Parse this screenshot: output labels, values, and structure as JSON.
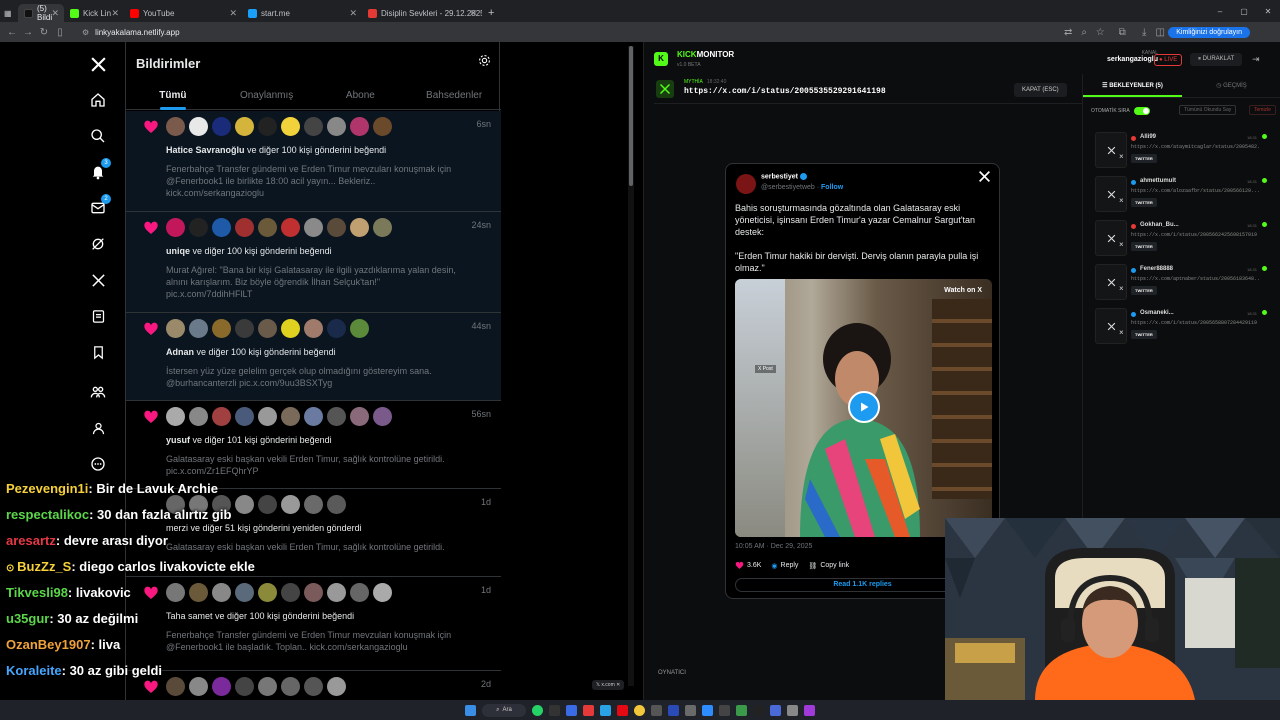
{
  "browser": {
    "tabs": [
      {
        "label": "(5) Bildi",
        "color": "#111"
      },
      {
        "label": "Kick Lin",
        "color": "#53fc18"
      },
      {
        "label": "YouTube",
        "color": "#ff0000"
      },
      {
        "label": "start.me",
        "color": "#18a0fb"
      },
      {
        "label": "Disiplin Sevkleri - 29.12.2025 -",
        "color": "#e53935"
      }
    ],
    "new_tab": "+",
    "url": "linkyakalama.netlify.app",
    "verify_label": "Kimliğinizi doğrulayın"
  },
  "x_sidebar": {
    "icons": [
      "x-logo-icon",
      "home-icon",
      "search-icon",
      "notifications-icon",
      "messages-icon",
      "grok-icon",
      "x-premium-icon",
      "lists-icon",
      "bookmarks-icon",
      "communities-icon",
      "profile-icon",
      "more-icon"
    ],
    "notif_badge": "3",
    "msg_badge": "2"
  },
  "notifications": {
    "title": "Bildirimler",
    "tabs": [
      "Tümü",
      "Onaylanmış",
      "Abone",
      "Bahsedenler"
    ],
    "items": [
      {
        "time": "6sn",
        "user": "Hatice Savranoğlu",
        "action": "ve diğer 100 kişi gönderini beğendi",
        "quote": "Fenerbahçe Transfer gündemi ve Erden Timur mevzuları konuşmak için @Fenerbook1 ile birlikte 18:00 acil yayın... Bekleriz.. kick.com/serkangazioglu"
      },
      {
        "time": "24sn",
        "user": "uniqe",
        "action": "ve diğer 100 kişi gönderini beğendi",
        "quote": "Murat Ağırel: \"Bana bir kişi Galatasaray ile ilgili yazdıklarıma yalan desin, alnını karışlarım. Biz böyle öğrendik İlhan Selçuk'tan!\" pic.x.com/7ddihHFlLT"
      },
      {
        "time": "44sn",
        "user": "Adnan",
        "action": "ve diğer 100 kişi gönderini beğendi",
        "quote": "İstersen yüz yüze gelelim gerçek olup olmadığını göstereyim sana. @burhancanterzli pic.x.com/9uu3BSXTyg"
      },
      {
        "time": "56sn",
        "user": "yusuf",
        "action": "ve diğer 101 kişi gönderini beğendi",
        "quote": "Galatasaray eski başkan vekili Erden Timur, sağlık kontrolüne getirildi. pic.x.com/Zr1EFQhrYP"
      },
      {
        "time": "1d",
        "user": "",
        "action": "merzi ve diğer 51 kişi gönderini yeniden gönderdi",
        "quote": "Galatasaray eski başkan vekili Erden Timur, sağlık kontrolüne getirildi."
      },
      {
        "time": "1d",
        "user": "",
        "action": "Taha samet ve diğer 100 kişi gönderini beğendi",
        "quote": "Fenerbahçe Transfer gündemi ve Erden Timur mevzuları konuşmak için @Fenerbook1 ile başladık. Toplan.. kick.com/serkangazioglu"
      },
      {
        "time": "2d",
        "user": "",
        "action": "",
        "quote": ""
      }
    ]
  },
  "chat": [
    {
      "user": "Pezevengin1i",
      "color": "#f7d13b",
      "msg": ": Bir de Lavuk Archie"
    },
    {
      "user": "respectalikoc",
      "color": "#5cd64b",
      "msg": ": 30 dan fazla alırtız gib"
    },
    {
      "user": "aresartz",
      "color": "#e63946",
      "msg": ": devre arası diyor"
    },
    {
      "user": "BuzZz_S",
      "color": "#f7d13b",
      "msg": ": diego carlos livakovicte ekle"
    },
    {
      "user": "Tikvesli98",
      "color": "#5cd64b",
      "msg": ": livakovic"
    },
    {
      "user": "u35gur",
      "color": "#5cd64b",
      "msg": ": 30 az değilmi"
    },
    {
      "user": "OzanBey1907",
      "color": "#f0a23b",
      "msg": ": liva"
    },
    {
      "user": "Koraleite",
      "color": "#47a6ff",
      "msg": ": 30 az gibi geldi"
    }
  ],
  "kickmonitor": {
    "brand_a": "KICK",
    "brand_b": "MONITOR",
    "version": "v1.0 BETA",
    "channel_label": "KANAL",
    "channel": "serkangazioglu",
    "live": "● LIVE",
    "pause": "⏸ DURAKLAT",
    "current_user": "MYTHİA",
    "current_time": "18:32:40",
    "current_link": "https://x.com/i/status/2005535529291641198",
    "close": "KAPAT (ESC)",
    "tab_waiting": "BEKLEYENLER (5)",
    "tab_history": "GEÇMİŞ",
    "auto_label": "OTOMATİK SIRA",
    "clear_label": "Tümünü Okundu Say",
    "delete_label": "Temizle",
    "queue": [
      {
        "user": "Alli99",
        "dot": "#e53935",
        "time": "18:31",
        "link": "https://x.com/ataymitcaglar/status/2005482...",
        "tag": "TWITTER"
      },
      {
        "user": "ahmettumult",
        "dot": "#1d9bf0",
        "time": "18:31",
        "link": "https://x.com/alozaafbr/status/200566129...",
        "tag": "TWITTER"
      },
      {
        "user": "Gokhan_Bu...",
        "dot": "#e53935",
        "time": "18:31",
        "link": "https://x.com/i/status/2005662425698157019",
        "tag": "TWITTER"
      },
      {
        "user": "Fener88888",
        "dot": "#1d9bf0",
        "time": "18:31",
        "link": "https://x.com/aptnaber/status/20056183648...",
        "tag": "TWITTER"
      },
      {
        "user": "Osmaneki...",
        "dot": "#1d9bf0",
        "time": "18:31",
        "link": "https://x.com/i/status/2005658807284429119",
        "tag": "TWITTER"
      }
    ],
    "player_label": "OYNATICI"
  },
  "embed": {
    "name": "serbestiyet",
    "handle": "@serbestiyetweb",
    "follow": "Follow",
    "text1": "Bahis soruşturmasında gözaltında olan Galatasaray eski yöneticisi, işinsanı Erden Timur'a yazar Cemalnur Sargut'tan destek:",
    "text2": "\"Erden Timur hakiki bir dervişti. Derviş olanın parayla pulla işi olmaz.\"",
    "watch": "Watch on X",
    "xpost": "X Post",
    "date": "10:05 AM · Dec 29, 2025",
    "likes": "3.6K",
    "reply": "Reply",
    "copy": "Copy link",
    "read_replies": "Read 1.1K replies"
  },
  "taskbar": {
    "search": "Ara",
    "xchip": "x.com"
  }
}
